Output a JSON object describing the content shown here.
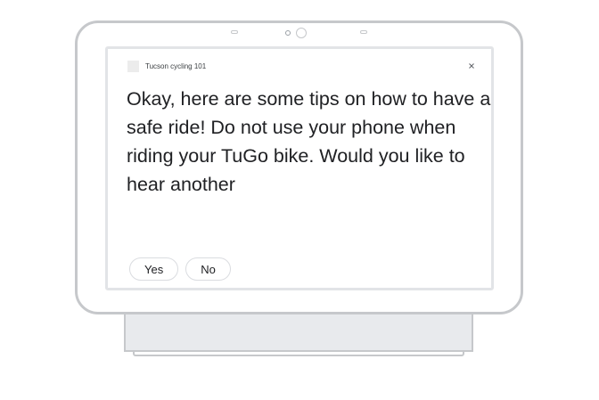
{
  "card": {
    "app_name": "Tucson cycling 101",
    "close_icon": "close-icon",
    "message": "Okay, here are some tips on how to have a safe ride! Do not use your phone when riding your TuGo bike. Would you like to hear another"
  },
  "suggestions": [
    {
      "label": "Yes"
    },
    {
      "label": "No"
    }
  ],
  "colors": {
    "device_outline": "#c6c8cb",
    "text": "#202124",
    "chip_border": "#dadce0"
  }
}
